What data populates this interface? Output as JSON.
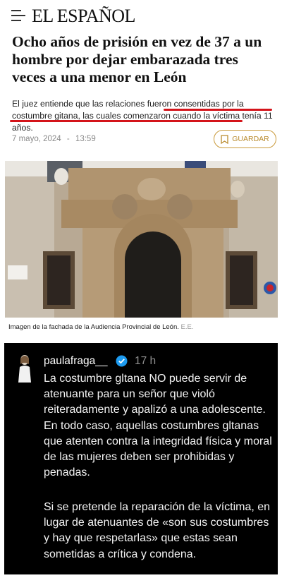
{
  "header": {
    "logo_text": "EL ESPAÑOL"
  },
  "article": {
    "headline": "Ocho años de prisión en vez de 37 a un hombre por dejar embarazada tres veces a una menor en León",
    "subtitle": "El juez entiende que las relaciones fueron consentidas por la costumbre gitana, las cuales comenzaron cuando la víctima tenía 11 años.",
    "date": "7 mayo, 2024",
    "time": "13:59",
    "date_separator": "-",
    "save_label": "GUARDAR",
    "caption": "Imagen de la fachada de la Audiencia Provincial de León.",
    "caption_credit": "E.E."
  },
  "post": {
    "username": "paulafraga__",
    "time": "17 h",
    "paragraph1": "La costumbre gltana NO puede servir de atenuante para un señor que violó reiteradamente y apalizó a una adolescente. En todo caso, aquellas costumbres gltanas que atenten contra la integridad física y moral de las mujeres deben ser prohibidas y penadas.",
    "paragraph2": "Si se pretende la reparación de la víctima, en lugar de atenuantes de «son sus costumbres y hay que respetarlas» que estas sean sometidas a crítica y condena."
  },
  "colors": {
    "accent_red": "#d4141a",
    "save_gold": "#b98b2e",
    "post_background": "#000000",
    "verified_blue": "#1d9bf0"
  },
  "icons": {
    "menu": "hamburger-menu-icon",
    "save": "bookmark-icon",
    "verified": "verified-badge-icon"
  }
}
